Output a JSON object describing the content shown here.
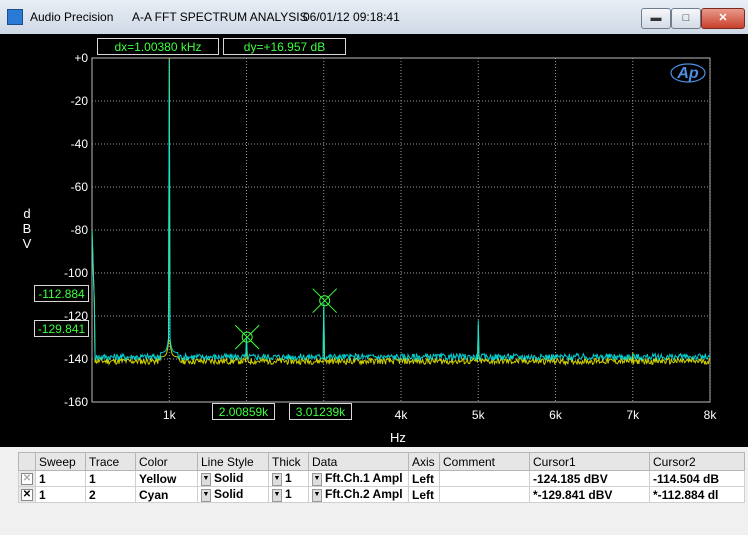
{
  "window": {
    "app_name": "Audio Precision",
    "title": "A-A FFT SPECTRUM ANALYSIS",
    "timestamp": "06/01/12 09:18:41",
    "min_glyph": "▬",
    "max_glyph": "□",
    "close_glyph": "✕"
  },
  "readouts": {
    "dx": "dx=1.00380 kHz",
    "dy": "dy=+16.957  dB",
    "cursor1_y": "-112.884",
    "cursor2_y": "-129.841",
    "cursor1_x": "2.00859k",
    "cursor2_x": "3.01239k"
  },
  "logo": "Ap",
  "chart_data": {
    "type": "line",
    "title": "",
    "xlabel": "Hz",
    "ylabel": "dBV",
    "ylabel_chars": [
      "d",
      "B",
      "V"
    ],
    "xlim": [
      0,
      8000
    ],
    "ylim": [
      -160,
      0
    ],
    "grid": true,
    "x_tick_labels": [
      "1k",
      "2k",
      "3k",
      "4k",
      "5k",
      "6k",
      "7k",
      "8k"
    ],
    "x_tick_values": [
      1000,
      2000,
      3000,
      4000,
      5000,
      6000,
      7000,
      8000
    ],
    "y_tick_labels": [
      "+0",
      "-20",
      "-40",
      "-60",
      "-80",
      "-100",
      "-120",
      "-140",
      "-160"
    ],
    "y_tick_values": [
      0,
      -20,
      -40,
      -60,
      -80,
      -100,
      -120,
      -140,
      -160
    ],
    "series": [
      {
        "name": "Fft.Ch.1 Ampl",
        "color": "#e6e600",
        "noise_floor": -141,
        "peaks": [
          [
            1000,
            0
          ],
          [
            2000,
            -131
          ],
          [
            3000,
            -116
          ],
          [
            5000,
            -124
          ],
          [
            7000,
            -137
          ]
        ]
      },
      {
        "name": "Fft.Ch.2 Ampl",
        "color": "#00e5e5",
        "noise_floor": -139,
        "peaks": [
          [
            1000,
            -1
          ],
          [
            2000,
            -130
          ],
          [
            3000,
            -114
          ],
          [
            5000,
            -122
          ],
          [
            7000,
            -138
          ]
        ]
      }
    ],
    "cursors": [
      {
        "x": 2008.59,
        "y": -129.841
      },
      {
        "x": 3012.39,
        "y": -112.884
      }
    ]
  },
  "table": {
    "headers": [
      "Sweep",
      "Trace",
      "Color",
      "Line Style",
      "Thick",
      "Data",
      "Axis",
      "Comment",
      "Cursor1",
      "Cursor2"
    ],
    "rows": [
      {
        "checked": false,
        "check_glyph": "✕",
        "sweep": "1",
        "trace": "1",
        "color": "Yellow",
        "style": "Solid",
        "thick": "1",
        "data": "Fft.Ch.1 Ampl",
        "axis": "Left",
        "comment": "",
        "cursor1": "-124.185 dBV",
        "cursor2": "-114.504 dB"
      },
      {
        "checked": true,
        "check_glyph": "✕",
        "sweep": "1",
        "trace": "2",
        "color": "Cyan",
        "style": "Solid",
        "thick": "1",
        "data": "Fft.Ch.2 Ampl",
        "axis": "Left",
        "comment": "",
        "cursor1": "*-129.841 dBV",
        "cursor2": "*-112.884 dl"
      }
    ]
  }
}
